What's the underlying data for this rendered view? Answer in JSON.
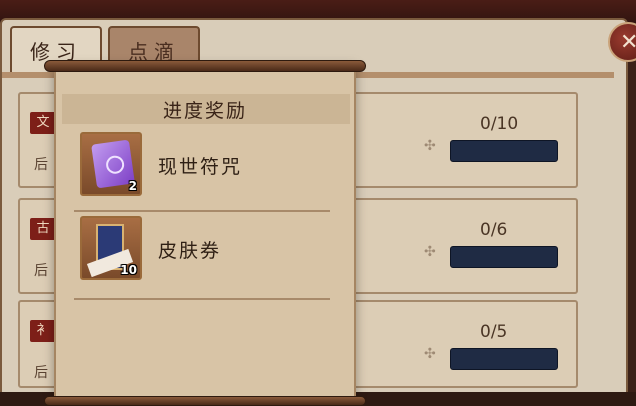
{
  "tabs": [
    {
      "label": "修习",
      "active": true
    },
    {
      "label": "点滴",
      "active": false
    }
  ],
  "close_label": "✕",
  "tasks": [
    {
      "badge": "文",
      "sub": "后",
      "progress_text": "0/10",
      "progress": 0
    },
    {
      "badge": "古",
      "sub": "后",
      "progress_text": "0/6",
      "progress": 0
    },
    {
      "badge": "衤",
      "sub": "后",
      "progress_text": "0/5",
      "progress": 0
    }
  ],
  "popup": {
    "title": "进度奖励",
    "rewards": [
      {
        "name": "现世符咒",
        "count": "2",
        "icon": "purple-talisman-icon"
      },
      {
        "name": "皮肤券",
        "count": "10",
        "icon": "skin-ticket-banner-icon"
      }
    ]
  },
  "colors": {
    "panel": "#d9cdb9",
    "progress_track": "#1f2b44",
    "accent_red": "#7d1f18"
  }
}
